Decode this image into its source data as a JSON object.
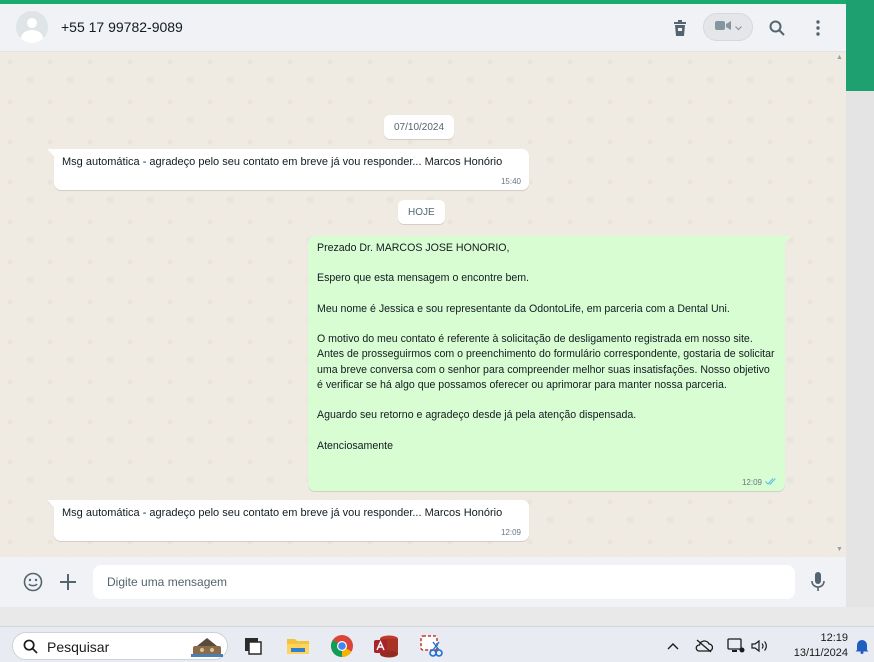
{
  "header": {
    "contact_name": "+55 17 99782-9089",
    "icons": [
      "avatar",
      "delete-icon",
      "video-call-icon",
      "chevron-down-icon",
      "search-icon",
      "more-options-icon"
    ]
  },
  "messages": {
    "date_chip_1": "07/10/2024",
    "msg1": {
      "text": "Msg automática - agradeço pelo seu contato em breve já vou responder... Marcos Honório",
      "time": "15:40"
    },
    "date_chip_2": "HOJE",
    "msg2": {
      "line1": "Prezado Dr.  MARCOS JOSE HONORIO,",
      "line2": "Espero que esta mensagem o encontre bem.",
      "line3": "Meu nome é Jessica e sou representante da OdontoLife, em parceria com a Dental Uni.",
      "line4": "O motivo do meu contato é referente à solicitação de desligamento registrada em nosso site.",
      "line5": "Antes de prosseguirmos com o preenchimento do formulário correspondente, gostaria de solicitar uma breve conversa com o senhor para compreender melhor suas insatisfações. Nosso objetivo é verificar se há algo que possamos oferecer ou aprimorar para manter nossa parceria.",
      "line6": "Aguardo seu retorno e agradeço desde já pela atenção dispensada.",
      "line7": "Atenciosamente",
      "time": "12:09",
      "read_color": "#53bdeb"
    },
    "msg3": {
      "text": "Msg automática - agradeço pelo seu contato em breve já vou responder... Marcos Honório",
      "time": "12:09"
    }
  },
  "composer": {
    "placeholder": "Digite uma mensagem",
    "icons": [
      "emoji-icon",
      "attach-plus-icon",
      "microphone-icon"
    ]
  },
  "taskbar": {
    "search_label": "Pesquisar",
    "apps": [
      "task-view-icon",
      "file-explorer-icon",
      "chrome-icon",
      "access-icon",
      "snipping-tool-icon"
    ],
    "time": "12:19",
    "date": "13/11/2024"
  },
  "colors": {
    "accent": "#1fa070",
    "outgoing_bubble": "#d9fdd3",
    "chat_background": "#efeae2"
  }
}
